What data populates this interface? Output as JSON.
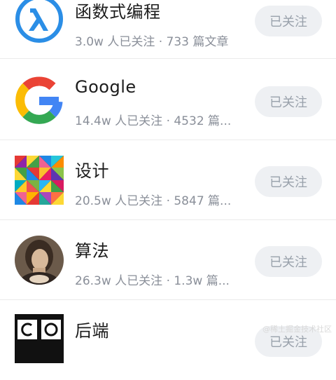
{
  "topics": [
    {
      "name": "函数式编程",
      "meta": "3.0w 人已关注 · 733 篇文章",
      "follow_label": "已关注",
      "icon": "lambda-icon",
      "icon_color": "#1e88e5"
    },
    {
      "name": "Google",
      "meta": "14.4w 人已关注 · 4532 篇...",
      "follow_label": "已关注",
      "icon": "google-logo",
      "icon_colors": [
        "#ea4335",
        "#fbbc05",
        "#34a853",
        "#4285f4"
      ]
    },
    {
      "name": "设计",
      "meta": "20.5w 人已关注 · 5847 篇...",
      "follow_label": "已关注",
      "icon": "geometric-pattern-icon"
    },
    {
      "name": "算法",
      "meta": "26.3w 人已关注 · 1.3w 篇...",
      "follow_label": "已关注",
      "icon": "portrait-avatar"
    },
    {
      "name": "后端",
      "meta": "",
      "follow_label": "已关注",
      "icon": "co-logo",
      "logo_text": "C O"
    }
  ],
  "watermark": "@稀土掘金技术社区"
}
